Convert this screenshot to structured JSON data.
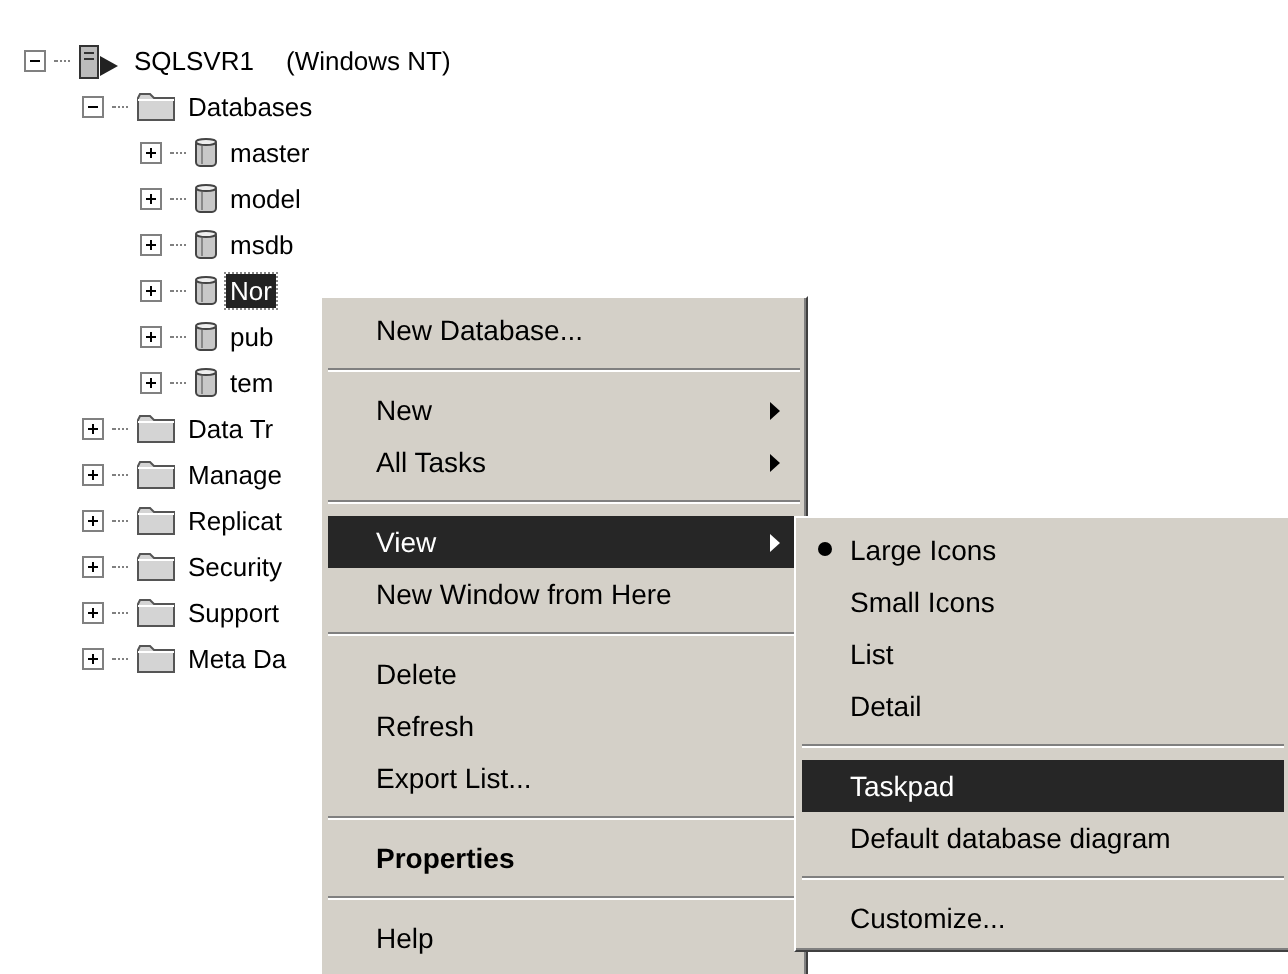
{
  "tree": [
    {
      "label": "SQLSVR1",
      "detail": "(Windows NT)",
      "kind": "server",
      "expanded": true,
      "selected": false,
      "children": [
        {
          "label": "Databases",
          "kind": "folder",
          "expanded": true,
          "selected": false,
          "children": [
            {
              "label": "master",
              "kind": "database",
              "expanded": false,
              "selected": false
            },
            {
              "label": "model",
              "kind": "database",
              "expanded": false,
              "selected": false
            },
            {
              "label": "msdb",
              "kind": "database",
              "expanded": false,
              "selected": false
            },
            {
              "label": "Nor",
              "kind": "database",
              "expanded": false,
              "selected": true
            },
            {
              "label": "pub",
              "kind": "database",
              "expanded": false,
              "selected": false
            },
            {
              "label": "tem",
              "kind": "database",
              "expanded": false,
              "selected": false
            }
          ]
        },
        {
          "label": "Data Tr",
          "kind": "folder",
          "expanded": false,
          "selected": false
        },
        {
          "label": "Manage",
          "kind": "folder",
          "expanded": false,
          "selected": false
        },
        {
          "label": "Replicat",
          "kind": "folder",
          "expanded": false,
          "selected": false
        },
        {
          "label": "Security",
          "kind": "folder",
          "expanded": false,
          "selected": false
        },
        {
          "label": "Support",
          "kind": "folder",
          "expanded": false,
          "selected": false
        },
        {
          "label": "Meta Da",
          "kind": "folder",
          "expanded": false,
          "selected": false
        }
      ]
    }
  ],
  "context_menu": [
    {
      "kind": "item",
      "label": "New Database...",
      "selected": false,
      "submenu": false,
      "bold": false
    },
    {
      "kind": "separator"
    },
    {
      "kind": "item",
      "label": "New",
      "selected": false,
      "submenu": true,
      "bold": false
    },
    {
      "kind": "item",
      "label": "All Tasks",
      "selected": false,
      "submenu": true,
      "bold": false
    },
    {
      "kind": "separator"
    },
    {
      "kind": "item",
      "label": "View",
      "selected": true,
      "submenu": true,
      "bold": false
    },
    {
      "kind": "item",
      "label": "New Window from Here",
      "selected": false,
      "submenu": false,
      "bold": false
    },
    {
      "kind": "separator"
    },
    {
      "kind": "item",
      "label": "Delete",
      "selected": false,
      "submenu": false,
      "bold": false
    },
    {
      "kind": "item",
      "label": "Refresh",
      "selected": false,
      "submenu": false,
      "bold": false
    },
    {
      "kind": "item",
      "label": "Export List...",
      "selected": false,
      "submenu": false,
      "bold": false
    },
    {
      "kind": "separator"
    },
    {
      "kind": "item",
      "label": "Properties",
      "selected": false,
      "submenu": false,
      "bold": true
    },
    {
      "kind": "separator"
    },
    {
      "kind": "item",
      "label": "Help",
      "selected": false,
      "submenu": false,
      "bold": false
    }
  ],
  "view_submenu": [
    {
      "kind": "item",
      "label": "Large Icons",
      "checked": true,
      "selected": false
    },
    {
      "kind": "item",
      "label": "Small Icons",
      "checked": false,
      "selected": false
    },
    {
      "kind": "item",
      "label": "List",
      "checked": false,
      "selected": false
    },
    {
      "kind": "item",
      "label": "Detail",
      "checked": false,
      "selected": false
    },
    {
      "kind": "separator"
    },
    {
      "kind": "item",
      "label": "Taskpad",
      "checked": false,
      "selected": true
    },
    {
      "kind": "item",
      "label": "Default database diagram",
      "checked": false,
      "selected": false
    },
    {
      "kind": "separator"
    },
    {
      "kind": "item",
      "label": "Customize...",
      "checked": false,
      "selected": false
    }
  ]
}
